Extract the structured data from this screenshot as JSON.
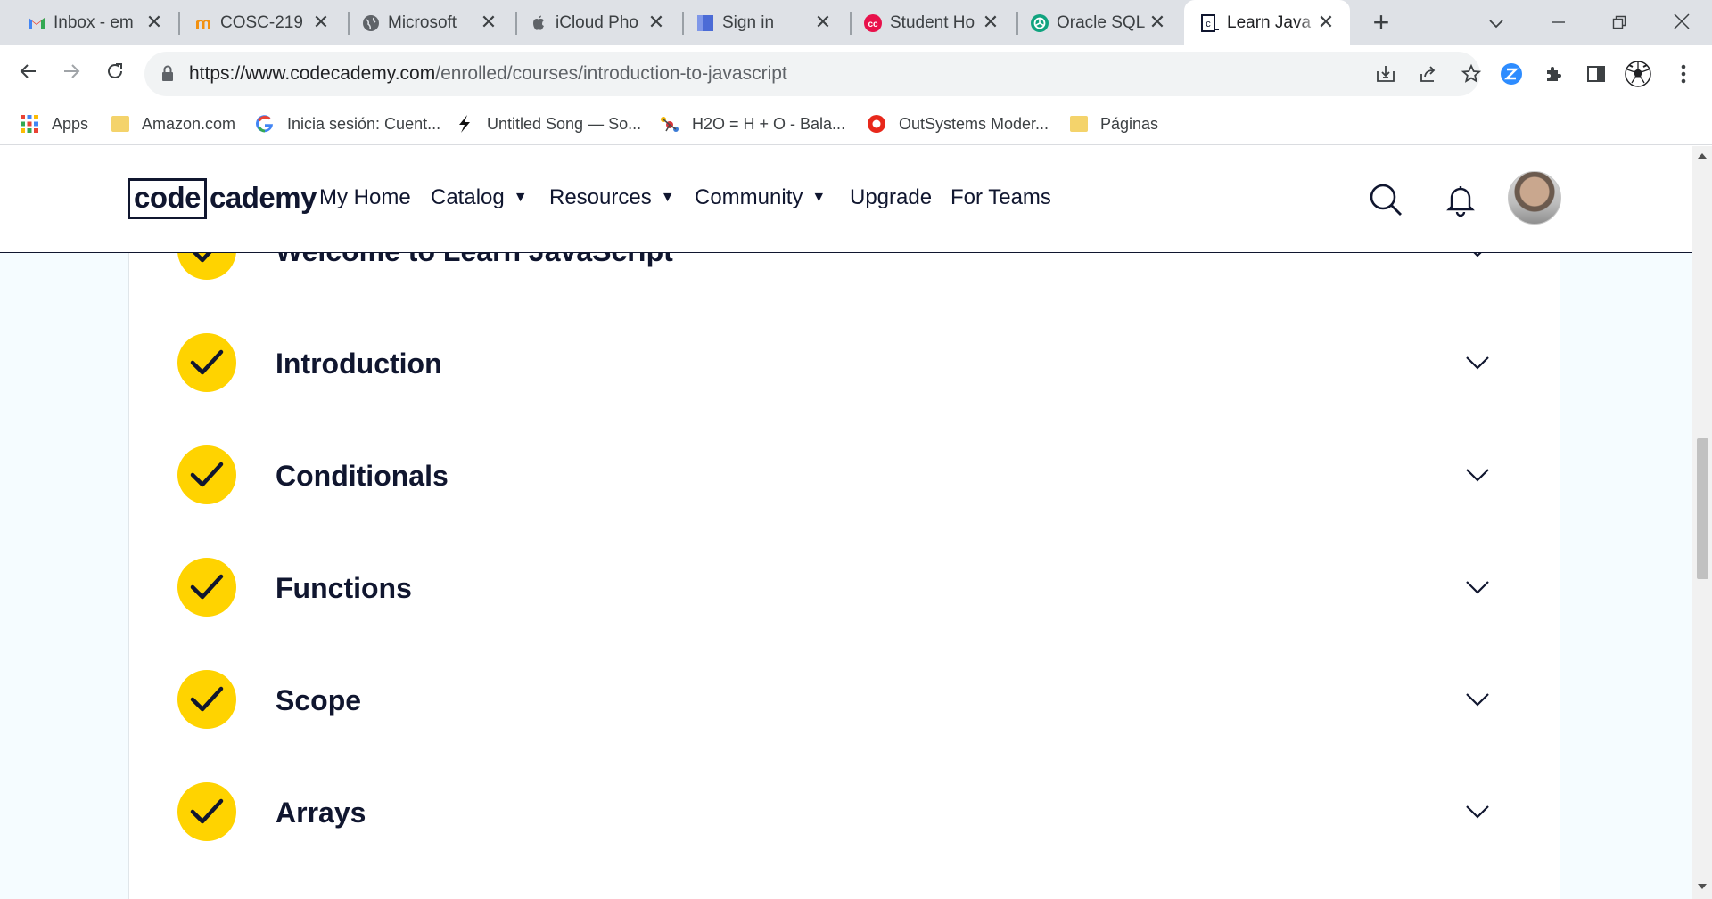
{
  "browser": {
    "tabs": [
      {
        "title": "Inbox - em",
        "favicon_color": "#ea4335",
        "active": false
      },
      {
        "title": "COSC-219",
        "favicon_color": "#f29111",
        "active": false
      },
      {
        "title": "Microsoft",
        "favicon_color": "#5f6368",
        "active": false
      },
      {
        "title": "iCloud Pho",
        "favicon_color": "#5f6368",
        "active": false
      },
      {
        "title": "Sign in",
        "favicon_color": "#4b6bd6",
        "active": false
      },
      {
        "title": "Student Ho",
        "favicon_color": "#e8114b",
        "active": false
      },
      {
        "title": "Oracle SQL",
        "favicon_color": "#10a37f",
        "active": false
      },
      {
        "title": "Learn Java",
        "favicon_color": "#10162f",
        "active": true
      }
    ],
    "tab_close_glyph": "✕",
    "new_tab_glyph": "+",
    "url_host": "https://www.codecademy.com",
    "url_path": "/enrolled/courses/introduction-to-javascript",
    "bookmarks": [
      {
        "label": "Apps",
        "icon": "apps-grid-icon"
      },
      {
        "label": "Amazon.com",
        "icon": "folder-icon"
      },
      {
        "label": "Inicia sesión: Cuent...",
        "icon": "google-icon"
      },
      {
        "label": "Untitled Song — So...",
        "icon": "soundtrap-icon"
      },
      {
        "label": "H2O = H + O - Bala...",
        "icon": "molecule-icon"
      },
      {
        "label": "OutSystems Moder...",
        "icon": "outsystems-icon"
      },
      {
        "label": "Páginas",
        "icon": "folder-icon"
      }
    ]
  },
  "site": {
    "logo_code": "code",
    "logo_rest": "cademy",
    "nav": [
      {
        "label": "My Home",
        "dropdown": false
      },
      {
        "label": "Catalog",
        "dropdown": true
      },
      {
        "label": "Resources",
        "dropdown": true
      },
      {
        "label": "Community",
        "dropdown": true
      },
      {
        "label": "Upgrade",
        "dropdown": false
      },
      {
        "label": "For Teams",
        "dropdown": false
      }
    ],
    "dropdown_caret": "▼"
  },
  "modules": [
    {
      "title": "Welcome to Learn JavaScript",
      "completed": true
    },
    {
      "title": "Introduction",
      "completed": true
    },
    {
      "title": "Conditionals",
      "completed": true
    },
    {
      "title": "Functions",
      "completed": true
    },
    {
      "title": "Scope",
      "completed": true
    },
    {
      "title": "Arrays",
      "completed": true
    }
  ],
  "colors": {
    "check_yellow": "#ffd300",
    "navy": "#10162f",
    "page_bg": "#f5fcff"
  }
}
